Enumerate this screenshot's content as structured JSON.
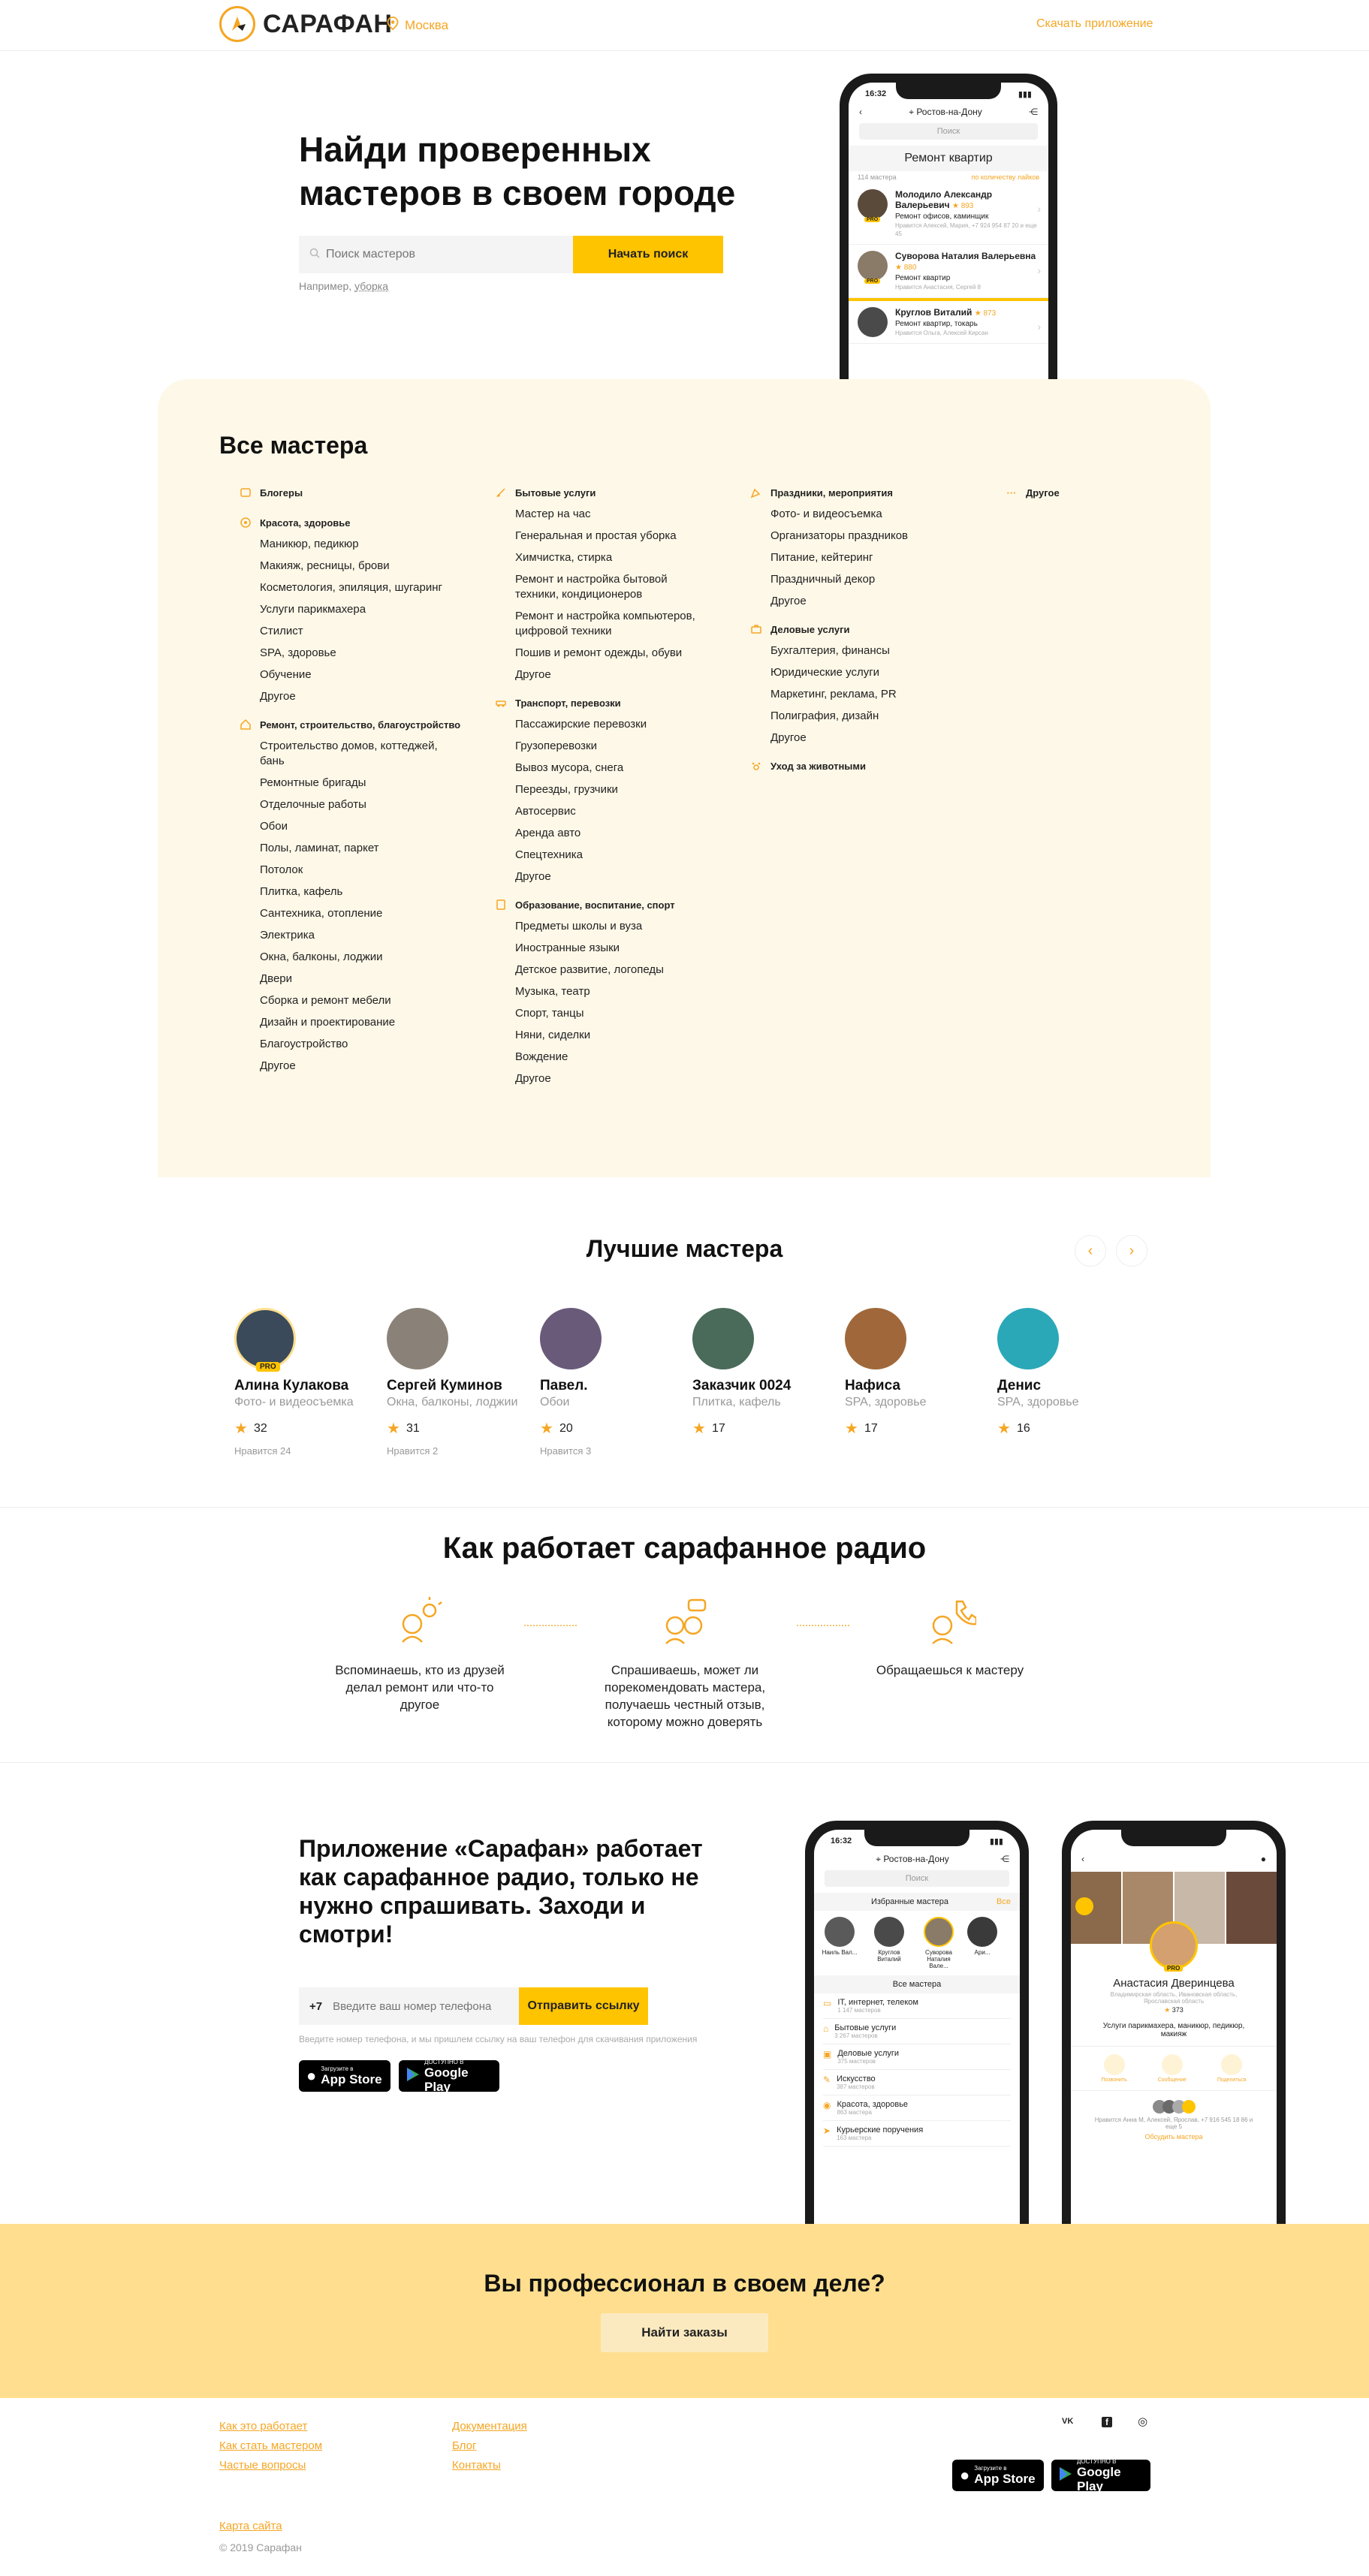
{
  "header": {
    "logo_text": "САРАФАН",
    "city": "Москва",
    "download_link": "Скачать приложение"
  },
  "hero": {
    "title": "Найди проверенных мастеров в своем городе",
    "search_placeholder": "Поиск мастеров",
    "search_button": "Начать поиск",
    "example_prefix": "Например,",
    "example_value": "уборка"
  },
  "phone_hero": {
    "time": "16:32",
    "city": "Ростов-на-Дону",
    "search_placeholder": "Поиск",
    "heading": "Ремонт квартир",
    "count": "114 мастера",
    "sort": "по количеству лайков",
    "items": [
      {
        "name": "Молодило Александр Валерьевич",
        "rating": "893",
        "desc": "Ремонт офисов, каминщик",
        "meta": "Нравится Алексей, Мария, +7 924 954 87 20 и еще 45",
        "pro": true
      },
      {
        "name": "Суворова Наталия Валерьевна",
        "rating": "880",
        "desc": "Ремонт квартир",
        "meta": "Нравится Анастасия, Сергей 8",
        "pro": true
      },
      {
        "name": "Круглов Виталий",
        "rating": "873",
        "desc": "Ремонт квартир, токарь",
        "meta": "Нравится Ольга, Алексей Кирсан",
        "pro": false
      }
    ]
  },
  "all_masters": {
    "title": "Все мастера",
    "columns": [
      [
        {
          "head": "Блогеры",
          "icon": "blog-icon",
          "items": []
        },
        {
          "head": "Красота, здоровье",
          "icon": "beauty-icon",
          "items": [
            "Маникюр, педикюр",
            "Макияж, ресницы, брови",
            "Косметология, эпиляция, шугаринг",
            "Услуги парикмахера",
            "Стилист",
            "SPA, здоровье",
            "Обучение",
            "Другое"
          ]
        },
        {
          "head": "Ремонт, строительство, благоустройство",
          "icon": "house-icon",
          "items": [
            "Строительство домов, коттеджей, бань",
            "Ремонтные бригады",
            "Отделочные работы",
            "Обои",
            "Полы, ламинат, паркет",
            "Потолок",
            "Плитка, кафель",
            "Сантехника, отопление",
            "Электрика",
            "Окна, балконы, лоджии",
            "Двери",
            "Сборка и ремонт мебели",
            "Дизайн и проектирование",
            "Благоустройство",
            "Другое"
          ]
        }
      ],
      [
        {
          "head": "Бытовые услуги",
          "icon": "broom-icon",
          "items": [
            "Мастер на час",
            "Генеральная и простая уборка",
            "Химчистка, стирка",
            "Ремонт и настройка бытовой техники, кондиционеров",
            "Ремонт и настройка компьютеров, цифровой техники",
            "Пошив и ремонт одежды, обуви",
            "Другое"
          ]
        },
        {
          "head": "Транспорт, перевозки",
          "icon": "car-icon",
          "items": [
            "Пассажирские перевозки",
            "Грузоперевозки",
            "Вывоз мусора, снега",
            "Переезды, грузчики",
            "Автосервис",
            "Аренда авто",
            "Спецтехника",
            "Другое"
          ]
        },
        {
          "head": "Образование, воспитание, спорт",
          "icon": "book-icon",
          "items": [
            "Предметы школы и вуза",
            "Иностранные языки",
            "Детское развитие, логопеды",
            "Музыка, театр",
            "Спорт, танцы",
            "Няни, сиделки",
            "Вождение",
            "Другое"
          ]
        }
      ],
      [
        {
          "head": "Праздники, мероприятия",
          "icon": "party-icon",
          "items": [
            "Фото- и видеосъемка",
            "Организаторы праздников",
            "Питание, кейтеринг",
            "Праздничный декор",
            "Другое"
          ]
        },
        {
          "head": "Деловые услуги",
          "icon": "briefcase-icon",
          "items": [
            "Бухгалтерия, финансы",
            "Юридические услуги",
            "Маркетинг, реклама, PR",
            "Полиграфия, дизайн",
            "Другое"
          ]
        },
        {
          "head": "Уход за животными",
          "icon": "paw-icon",
          "items": []
        }
      ],
      [
        {
          "head": "Другое",
          "icon": "dots-icon",
          "items": []
        }
      ]
    ]
  },
  "best_masters": {
    "title": "Лучшие мастера",
    "items": [
      {
        "name": "Алина Кулакова",
        "category": "Фото- и видеосъемка",
        "rating": "32",
        "likes": "Нравится 24",
        "pro": true,
        "color": "#3a4a5a"
      },
      {
        "name": "Сергей Куминов",
        "category": "Окна, балконы, лоджии",
        "rating": "31",
        "likes": "Нравится 2",
        "pro": false,
        "color": "#8a8278"
      },
      {
        "name": "Павел.",
        "category": "Обои",
        "rating": "20",
        "likes": "Нравится 3",
        "pro": false,
        "color": "#6a5a7a"
      },
      {
        "name": "Заказчик 0024",
        "category": "Плитка, кафель",
        "rating": "17",
        "likes": "",
        "pro": false,
        "color": "#4a6a5a"
      },
      {
        "name": "Нафиса",
        "category": "SPA, здоровье",
        "rating": "17",
        "likes": "",
        "pro": false,
        "color": "#a0683a"
      },
      {
        "name": "Денис",
        "category": "SPA, здоровье",
        "rating": "16",
        "likes": "",
        "pro": false,
        "color": "#2aa8b8"
      }
    ]
  },
  "how_it_works": {
    "title": "Как работает сарафанное радио",
    "steps": [
      "Вспоминаешь, кто из друзей делал ремонт или что-то другое",
      "Спрашиваешь, может ли порекомендовать мастера, получаешь честный отзыв, которому можно доверять",
      "Обращаешься к мастеру"
    ]
  },
  "app_promo": {
    "title": "Приложение «Сарафан» работает как сарафанное радио, только не нужно спрашивать. Заходи и смотри!",
    "phone_prefix": "+7",
    "phone_placeholder": "Введите ваш номер телефона",
    "send_button": "Отправить ссылку",
    "note": "Введите номер телефона, и мы пришлем ссылку на ваш телефон для скачивания приложения",
    "app_store_small": "Загрузите в",
    "app_store": "App Store",
    "google_play_small": "ДОСТУПНО В",
    "google_play": "Google Play"
  },
  "phone_app1": {
    "time": "16:32",
    "city": "Ростов-на-Дону",
    "search_placeholder": "Поиск",
    "fav_title": "Избранные мастера",
    "fav_all": "Все",
    "favs": [
      "Наиль Вал...",
      "Круглов Виталий",
      "Суворова Наталия Вале...",
      "Ари..."
    ],
    "all_title": "Все мастера",
    "cats": [
      {
        "name": "IT, интернет, телеком",
        "count": "1 147 мастеров"
      },
      {
        "name": "Бытовые услуги",
        "count": "3 267 мастеров"
      },
      {
        "name": "Деловые услуги",
        "count": "375 мастеров"
      },
      {
        "name": "Искусство",
        "count": "387 мастеров"
      },
      {
        "name": "Красота, здоровье",
        "count": "863 мастера"
      },
      {
        "name": "Курьерские поручения",
        "count": "163 мастера"
      }
    ]
  },
  "phone_app2": {
    "name": "Анастасия Дверинцева",
    "region": "Владимирская область, Ивановская область, Ярославская область",
    "rating": "373",
    "services": "Услуги парикмахера, маникюр, педикюр, макияж",
    "actions": [
      "Позвонить",
      "Сообщение",
      "Поделиться"
    ],
    "likes": "Нравится Анна М, Алексей, Ярослав, +7 916 545 18 86 и еще 5",
    "discuss": "Обсудить мастера"
  },
  "pro_cta": {
    "title": "Вы профессионал в своем деле?",
    "button": "Найти заказы"
  },
  "footer": {
    "col1": [
      "Как это работает",
      "Как стать мастером",
      "Частые вопросы"
    ],
    "col2": [
      "Документация",
      "Блог",
      "Контакты"
    ],
    "sitemap": "Карта сайта",
    "copyright": "© 2019 Сарафан",
    "social": [
      "VK",
      "f",
      "◎"
    ]
  },
  "colors": {
    "accent": "#ffc400",
    "orange": "#f5a623",
    "cream": "#fef8e8",
    "cta_band": "#ffdf8f"
  }
}
